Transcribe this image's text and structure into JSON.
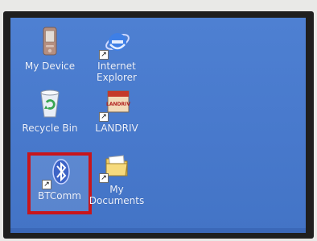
{
  "desktop": {
    "icons": [
      {
        "label": "My Device",
        "icon": "device-icon"
      },
      {
        "label": "Internet Explorer",
        "icon": "internet-explorer-icon"
      },
      {
        "label": "Recycle Bin",
        "icon": "recycle-bin-icon"
      },
      {
        "label": "LANDRIV",
        "icon": "landriv-icon",
        "logo_text": "LANDRIV"
      },
      {
        "label": "BTComm",
        "icon": "bluetooth-icon"
      },
      {
        "label": "My Documents",
        "icon": "folder-icon"
      }
    ],
    "shortcut_arrow": "↗",
    "selection_color": "#c8151b",
    "background_color": "#4a7bcf"
  }
}
